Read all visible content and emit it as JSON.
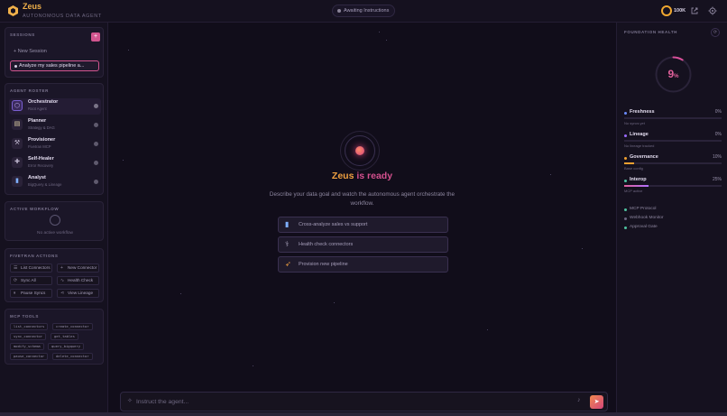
{
  "header": {
    "brand": "Zeus",
    "subtitle": "AUTONOMOUS DATA AGENT",
    "status": "Awaiting Instructions",
    "score": "100K"
  },
  "sessions": {
    "title": "SESSIONS",
    "new_label": "New Session",
    "items": [
      "Analyze my sales pipeline a..."
    ]
  },
  "roster": {
    "title": "AGENT ROSTER",
    "agents": [
      {
        "name": "Orchestrator",
        "role": "Root Agent",
        "icon": "hexagon-icon"
      },
      {
        "name": "Planner",
        "role": "Strategy & DAG",
        "icon": "clipboard-icon"
      },
      {
        "name": "Provisioner",
        "role": "Fivetran MCP",
        "icon": "wrench-icon"
      },
      {
        "name": "Self-Healer",
        "role": "Error Recovery",
        "icon": "heal-icon"
      },
      {
        "name": "Analyst",
        "role": "BigQuery & Lineage",
        "icon": "chart-icon"
      }
    ]
  },
  "workflow": {
    "title": "ACTIVE WORKFLOW",
    "empty": "No active workflow"
  },
  "actions": {
    "title": "FIVETRAN ACTIONS",
    "items": [
      "List Connectors",
      "New Connector",
      "Sync All",
      "Health Check",
      "Pause Syncs",
      "View Lineage"
    ]
  },
  "mcp": {
    "title": "MCP TOOLS",
    "tools": [
      "list_connectors",
      "create_connector",
      "sync_connector",
      "get_tables",
      "modify_schema",
      "query_bigquery",
      "pause_connector",
      "delete_connector"
    ]
  },
  "main": {
    "ready_prefix": "Zeus",
    "ready_suffix": "is ready",
    "description": "Describe your data goal and watch the autonomous agent orchestrate the workflow.",
    "suggestions": [
      {
        "label": "Cross-analyze sales vs support",
        "icon": "chart-icon"
      },
      {
        "label": "Health check connectors",
        "icon": "stethoscope-icon"
      },
      {
        "label": "Provision new pipeline",
        "icon": "rocket-icon"
      }
    ],
    "input_placeholder": "Instruct the agent..."
  },
  "health": {
    "title": "FOUNDATION HEALTH",
    "score": "9",
    "score_unit": "%",
    "score_value": 9,
    "metrics": [
      {
        "name": "Freshness",
        "percent": "0%",
        "value": 0,
        "sub": "No syncs yet",
        "color": "#6b8cff"
      },
      {
        "name": "Lineage",
        "percent": "0%",
        "value": 0,
        "sub": "No lineage tracked",
        "color": "#9b6bff"
      },
      {
        "name": "Governance",
        "percent": "10%",
        "value": 10,
        "sub": "Base config",
        "color": "#f0a030"
      },
      {
        "name": "Interop",
        "percent": "25%",
        "value": 25,
        "sub": "MCP active",
        "color": "#e0609a"
      }
    ],
    "features": [
      {
        "label": "MCP Protocol",
        "color": "#4fc3a1"
      },
      {
        "label": "Webhook Monitor",
        "color": "#6b6580"
      },
      {
        "label": "Approval Gate",
        "color": "#4fc3a1"
      }
    ]
  }
}
